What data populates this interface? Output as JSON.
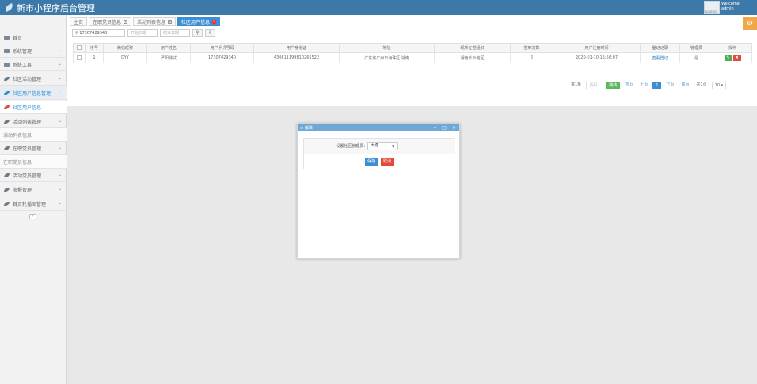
{
  "app": {
    "title": "新市小程序后台管理",
    "welcome": "Welcome",
    "user": "admin",
    "avatar_text": "Loading"
  },
  "sidebar": {
    "items": [
      {
        "label": "首页"
      },
      {
        "label": "系统管理"
      },
      {
        "label": "系统工具"
      },
      {
        "label": "社区活动管理"
      },
      {
        "label": "社区用户信息管理"
      },
      {
        "label": "社区用户信息"
      },
      {
        "label": "活动列表管理"
      },
      {
        "label": "活动列表信息"
      },
      {
        "label": "在职党员管理"
      },
      {
        "label": "在职党员信息"
      },
      {
        "label": "活动党员管理"
      },
      {
        "label": "海报管理"
      },
      {
        "label": "首页轮播图管理"
      }
    ],
    "collapse": "‹"
  },
  "tabs": [
    {
      "label": "主页"
    },
    {
      "label": "在职党员信息"
    },
    {
      "label": "活动列表信息"
    },
    {
      "label": "社区用户信息"
    }
  ],
  "filters": {
    "phone": "17307429340",
    "start_placeholder": "开始日期",
    "end_placeholder": "结束日期"
  },
  "table": {
    "headers": [
      "序号",
      "微信昵称",
      "用户姓名",
      "用户手机号码",
      "用户身份证",
      "地址",
      "现所在党组织",
      "签到次数",
      "用户注册时间",
      "登记记录",
      "管理员",
      "操作"
    ],
    "row": {
      "index": "1",
      "nickname": "DYY",
      "name": "严阳测试",
      "phone": "17307429340",
      "id_card": "430611199810265522",
      "address": "广东省广州市海珠区 湖南",
      "party_org": "湖南长沙地区",
      "signins": "6",
      "registered": "2020-01-10 15:56:07",
      "record_link": "查看登记",
      "admin": "是"
    }
  },
  "pager": {
    "total_label": "共1条",
    "page_placeholder": "页码",
    "go": "跳转",
    "first": "首页",
    "prev": "上页",
    "current": "1",
    "next": "下页",
    "last": "尾页",
    "pages": "共1页",
    "size": "10"
  },
  "modal": {
    "title": "编辑",
    "field_label": "设置社区管理员:",
    "field_value": "大塘",
    "save": "保存",
    "cancel": "取消"
  }
}
